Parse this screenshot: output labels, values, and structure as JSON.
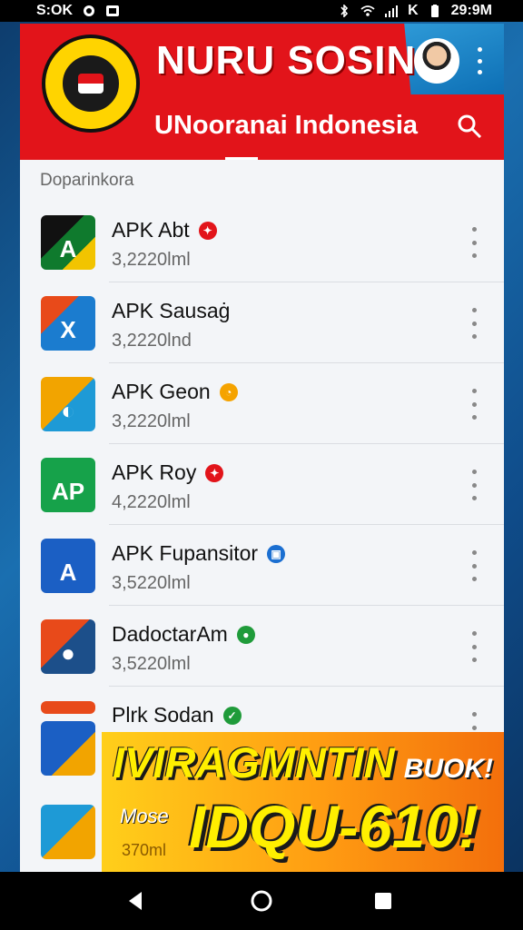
{
  "status_bar": {
    "left_text": "S:OK",
    "right_text": "29:9M",
    "carrier_glyph": "K"
  },
  "header": {
    "title": "NURU SOSIN",
    "subtitle": "UNooranai Indonesia",
    "brand_color": "#e2141a",
    "accent_color": "#0d6fb5"
  },
  "section": {
    "label": "Doparinkora"
  },
  "apps": [
    {
      "name": "APK Abt",
      "size": "3,2220lml",
      "badge_color": "#e2141a",
      "icon_bg": "#0f7a2d"
    },
    {
      "name": "APK Sausaġ",
      "size": "3,2220lnd",
      "badge_color": null,
      "icon_bg": "#1b7ccf"
    },
    {
      "name": "APK Geon",
      "size": "3,2220lml",
      "badge_color": "#f5a300",
      "icon_bg": "#f2a400"
    },
    {
      "name": "APK Roy",
      "size": "4,2220lml",
      "badge_color": "#e2141a",
      "icon_bg": "#16a24a"
    },
    {
      "name": "APK Fupansitor",
      "size": "3,5220lml",
      "badge_color": "#1b6fd1",
      "icon_bg": "#1b5fc4"
    },
    {
      "name": "DadoctarAm",
      "size": "3,5220lml",
      "badge_color": "#1f9b3a",
      "icon_bg": "#1c4f8a"
    },
    {
      "name": "Plrk Sodan",
      "size": "",
      "badge_color": "#1f9b3a",
      "icon_bg": "#e84a1a"
    }
  ],
  "banner": {
    "line1": "IVIRAGMNTIN",
    "line1_small": "BUOK!",
    "line2_prefix": "Mose",
    "line2_big": "IDQU-610!",
    "size_text": "370ml"
  },
  "navigation": {
    "back_icon": "back-triangle-icon",
    "home_icon": "home-circle-icon",
    "recent_icon": "recent-square-icon"
  }
}
